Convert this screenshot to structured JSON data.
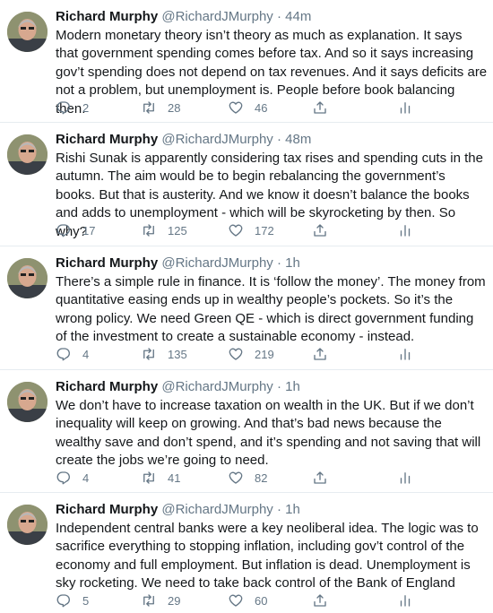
{
  "tweets": [
    {
      "name": "Richard Murphy",
      "handle": "@RichardJMurphy",
      "time": "44m",
      "text": "Modern monetary theory isn’t theory as much as explanation. It says that government spending comes before tax. And so it says increasing gov’t spending does not depend on tax revenues. And it says deficits are not a problem, but unemployment is. People before book balancing then.",
      "replies": "2",
      "retweets": "28",
      "likes": "46"
    },
    {
      "name": "Richard Murphy",
      "handle": "@RichardJMurphy",
      "time": "48m",
      "text": "Rishi Sunak is apparently considering tax rises and spending cuts in the autumn. The aim would be to begin rebalancing the government’s books. But that is austerity. And we know it doesn’t balance the books and adds to unemployment - which will be skyrocketing by then. So why?",
      "replies": "17",
      "retweets": "125",
      "likes": "172"
    },
    {
      "name": "Richard Murphy",
      "handle": "@RichardJMurphy",
      "time": "1h",
      "text": "There’s a simple rule in finance. It is ‘follow the money’. The money from quantitative easing ends up in wealthy people’s pockets. So it’s the wrong policy. We need Green QE - which is direct government funding of the investment to create a sustainable economy - instead.",
      "replies": "4",
      "retweets": "135",
      "likes": "219"
    },
    {
      "name": "Richard Murphy",
      "handle": "@RichardJMurphy",
      "time": "1h",
      "text": "We don’t have to increase taxation on wealth in the UK. But if we don’t inequality will keep on growing. And that’s bad news because the wealthy save and don’t spend, and it’s spending and not saving that will create the jobs we’re going to need.",
      "replies": "4",
      "retweets": "41",
      "likes": "82"
    },
    {
      "name": "Richard Murphy",
      "handle": "@RichardJMurphy",
      "time": "1h",
      "text": "Independent central banks were a key neoliberal idea. The logic was to sacrifice everything to stopping inflation, including gov’t control of the economy and full employment. But inflation is dead. Unemployment is sky rocketing. We need to take back control of the Bank of England",
      "replies": "5",
      "retweets": "29",
      "likes": "60"
    }
  ],
  "separator": " · ",
  "icons": [
    "reply-icon",
    "retweet-icon",
    "like-icon",
    "share-icon",
    "analytics-icon"
  ],
  "colors": {
    "text": "#14171a",
    "secondary": "#657786",
    "divider": "#e6ecf0"
  }
}
